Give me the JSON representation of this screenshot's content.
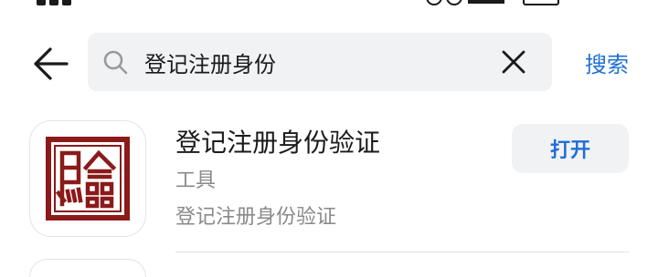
{
  "search": {
    "query": "登记注册身份",
    "action_label": "搜索"
  },
  "result": {
    "name": "登记注册身份验证",
    "category": "工具",
    "description": "登记注册身份验证",
    "open_label": "打开",
    "logo_color": "#8b1a1a"
  },
  "colors": {
    "accent": "#1f6fd6",
    "field_bg": "#f1f2f4",
    "secondary_text": "#8a8a8a"
  },
  "icons": {
    "back": "arrow-left-icon",
    "search": "search-icon",
    "clear": "close-icon"
  }
}
